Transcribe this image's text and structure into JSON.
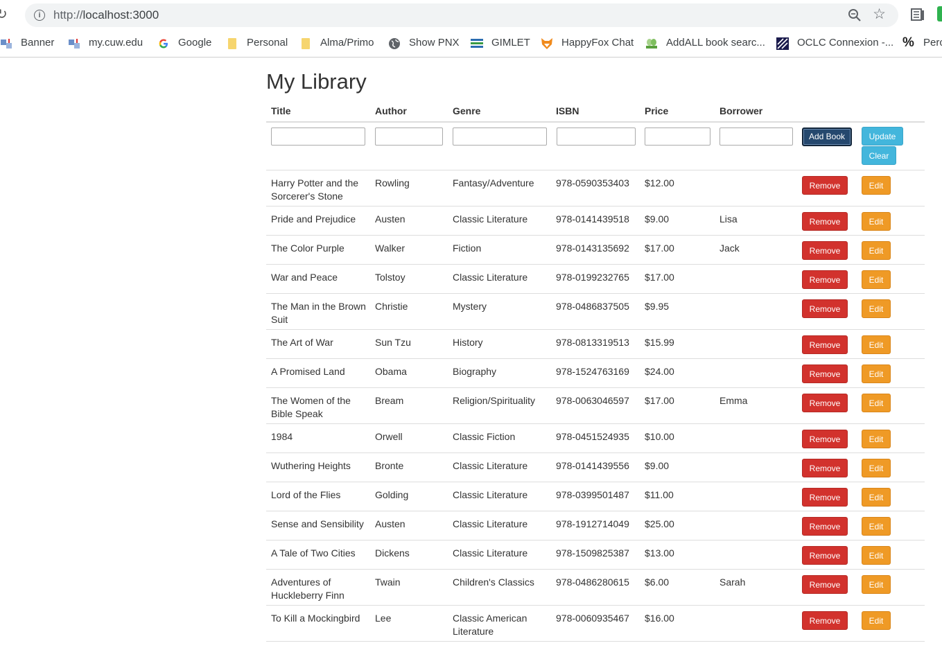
{
  "browser": {
    "url_scheme": "http://",
    "url_host": "localhost:3000",
    "bookmarks": [
      {
        "label": "Banner",
        "icon": "banner-icon"
      },
      {
        "label": "my.cuw.edu",
        "icon": "cuw-icon"
      },
      {
        "label": "Google",
        "icon": "google-icon"
      },
      {
        "label": "Personal",
        "icon": "folder-icon"
      },
      {
        "label": "Alma/Primo",
        "icon": "folder-icon"
      },
      {
        "label": "Show PNX",
        "icon": "globe-icon"
      },
      {
        "label": "GIMLET",
        "icon": "gimlet-icon"
      },
      {
        "label": "HappyFox Chat",
        "icon": "fox-icon"
      },
      {
        "label": "AddALL book searc...",
        "icon": "addall-icon"
      },
      {
        "label": "OCLC Connexion -...",
        "icon": "oclc-icon"
      },
      {
        "label": "Perc",
        "icon": "percent-icon"
      }
    ]
  },
  "page": {
    "title": "My Library",
    "columns": [
      "Title",
      "Author",
      "Genre",
      "ISBN",
      "Price",
      "Borrower"
    ],
    "buttons": {
      "add": "Add Book",
      "update": "Update",
      "clear": "Clear",
      "remove": "Remove",
      "edit": "Edit"
    },
    "inputs": {
      "title": "",
      "author": "",
      "genre": "",
      "isbn": "",
      "price": "",
      "borrower": ""
    },
    "books": [
      {
        "title": [
          "Harry Potter and the",
          "Sorcerer's Stone"
        ],
        "author": "Rowling",
        "genre": [
          "Fantasy/Adventure"
        ],
        "isbn": "978-0590353403",
        "price": "$12.00",
        "borrower": ""
      },
      {
        "title": [
          "Pride and Prejudice"
        ],
        "author": "Austen",
        "genre": [
          "Classic Literature"
        ],
        "isbn": "978-0141439518",
        "price": "$9.00",
        "borrower": "Lisa"
      },
      {
        "title": [
          "The Color Purple"
        ],
        "author": "Walker",
        "genre": [
          "Fiction"
        ],
        "isbn": "978-0143135692",
        "price": "$17.00",
        "borrower": "Jack"
      },
      {
        "title": [
          "War and Peace"
        ],
        "author": "Tolstoy",
        "genre": [
          "Classic Literature"
        ],
        "isbn": "978-0199232765",
        "price": "$17.00",
        "borrower": ""
      },
      {
        "title": [
          "The Man in the Brown",
          "Suit"
        ],
        "author": "Christie",
        "genre": [
          "Mystery"
        ],
        "isbn": "978-0486837505",
        "price": "$9.95",
        "borrower": ""
      },
      {
        "title": [
          "The Art of War"
        ],
        "author": "Sun Tzu",
        "genre": [
          "History"
        ],
        "isbn": "978-0813319513",
        "price": "$15.99",
        "borrower": ""
      },
      {
        "title": [
          "A Promised Land"
        ],
        "author": "Obama",
        "genre": [
          "Biography"
        ],
        "isbn": "978-1524763169",
        "price": "$24.00",
        "borrower": ""
      },
      {
        "title": [
          "The Women of the",
          "Bible Speak"
        ],
        "author": "Bream",
        "genre": [
          "Religion/Spirituality"
        ],
        "isbn": "978-0063046597",
        "price": "$17.00",
        "borrower": "Emma"
      },
      {
        "title": [
          "1984"
        ],
        "author": "Orwell",
        "genre": [
          "Classic Fiction"
        ],
        "isbn": "978-0451524935",
        "price": "$10.00",
        "borrower": ""
      },
      {
        "title": [
          "Wuthering Heights"
        ],
        "author": "Bronte",
        "genre": [
          "Classic Literature"
        ],
        "isbn": "978-0141439556",
        "price": "$9.00",
        "borrower": ""
      },
      {
        "title": [
          "Lord of the Flies"
        ],
        "author": "Golding",
        "genre": [
          "Classic Literature"
        ],
        "isbn": "978-0399501487",
        "price": "$11.00",
        "borrower": ""
      },
      {
        "title": [
          "Sense and Sensibility"
        ],
        "author": "Austen",
        "genre": [
          "Classic Literature"
        ],
        "isbn": "978-1912714049",
        "price": "$25.00",
        "borrower": ""
      },
      {
        "title": [
          "A Tale of Two Cities"
        ],
        "author": "Dickens",
        "genre": [
          "Classic Literature"
        ],
        "isbn": "978-1509825387",
        "price": "$13.00",
        "borrower": ""
      },
      {
        "title": [
          "Adventures of",
          "Huckleberry Finn"
        ],
        "author": "Twain",
        "genre": [
          "Children's Classics"
        ],
        "isbn": "978-0486280615",
        "price": "$6.00",
        "borrower": "Sarah"
      },
      {
        "title": [
          "To Kill a Mockingbird"
        ],
        "author": "Lee",
        "genre": [
          "Classic American",
          "Literature"
        ],
        "isbn": "978-0060935467",
        "price": "$16.00",
        "borrower": ""
      }
    ]
  },
  "colors": {
    "remove": "#d2322d",
    "edit": "#ef9a26",
    "update": "#43b6dc",
    "add": "#25486e"
  }
}
